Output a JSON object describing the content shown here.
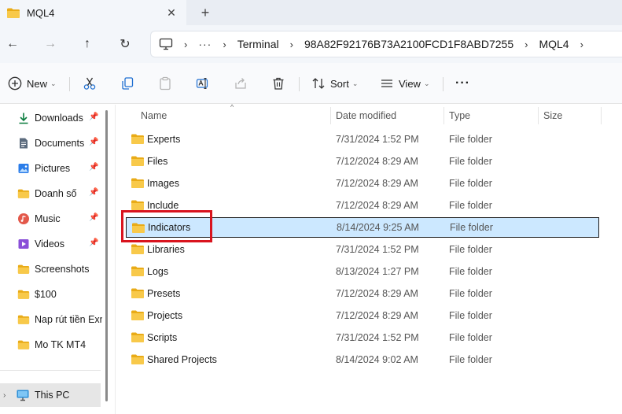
{
  "tab": {
    "title": "MQL4",
    "close_glyph": "✕",
    "new_tab_glyph": "+"
  },
  "nav": {
    "back_glyph": "←",
    "forward_glyph": "→",
    "up_glyph": "↑",
    "refresh_glyph": "↻"
  },
  "address": {
    "overflow_glyph": "···",
    "separator_glyph": "›",
    "crumbs": [
      "Terminal",
      "98A82F92176B73A2100FCD1F8ABD7255",
      "MQL4"
    ]
  },
  "toolbar": {
    "new_label": "New",
    "sort_label": "Sort",
    "view_label": "View",
    "more_glyph": "···",
    "caret_glyph": "⌄"
  },
  "sidebar": {
    "pin_glyph": "📌",
    "items": [
      {
        "label": "Downloads",
        "icon": "download-icon",
        "pinned": true
      },
      {
        "label": "Documents",
        "icon": "document-icon",
        "pinned": true
      },
      {
        "label": "Pictures",
        "icon": "picture-icon",
        "pinned": true
      },
      {
        "label": "Doanh số",
        "icon": "folder-icon",
        "pinned": true
      },
      {
        "label": "Music",
        "icon": "music-icon",
        "pinned": true
      },
      {
        "label": "Videos",
        "icon": "video-icon",
        "pinned": true
      },
      {
        "label": "Screenshots",
        "icon": "folder-icon",
        "pinned": false
      },
      {
        "label": "$100",
        "icon": "folder-icon",
        "pinned": false
      },
      {
        "label": "Nap rút tiền Exn",
        "icon": "folder-icon",
        "pinned": false
      },
      {
        "label": "Mo TK MT4",
        "icon": "folder-icon",
        "pinned": false
      }
    ],
    "this_pc": {
      "label": "This PC",
      "chevron_glyph": "›"
    }
  },
  "columns": {
    "name": "Name",
    "date": "Date modified",
    "type": "Type",
    "size": "Size",
    "sort_glyph": "^"
  },
  "files": [
    {
      "name": "Experts",
      "date": "7/31/2024 1:52 PM",
      "type": "File folder",
      "selected": false
    },
    {
      "name": "Files",
      "date": "7/12/2024 8:29 AM",
      "type": "File folder",
      "selected": false
    },
    {
      "name": "Images",
      "date": "7/12/2024 8:29 AM",
      "type": "File folder",
      "selected": false
    },
    {
      "name": "Include",
      "date": "7/12/2024 8:29 AM",
      "type": "File folder",
      "selected": false
    },
    {
      "name": "Indicators",
      "date": "8/14/2024 9:25 AM",
      "type": "File folder",
      "selected": true
    },
    {
      "name": "Libraries",
      "date": "7/31/2024 1:52 PM",
      "type": "File folder",
      "selected": false
    },
    {
      "name": "Logs",
      "date": "8/13/2024 1:27 PM",
      "type": "File folder",
      "selected": false
    },
    {
      "name": "Presets",
      "date": "7/12/2024 8:29 AM",
      "type": "File folder",
      "selected": false
    },
    {
      "name": "Projects",
      "date": "7/12/2024 8:29 AM",
      "type": "File folder",
      "selected": false
    },
    {
      "name": "Scripts",
      "date": "7/31/2024 1:52 PM",
      "type": "File folder",
      "selected": false
    },
    {
      "name": "Shared Projects",
      "date": "8/14/2024 9:02 AM",
      "type": "File folder",
      "selected": false
    }
  ],
  "colors": {
    "folder": "#f8c94a",
    "folder_dark": "#e9ab17",
    "selection": "#cce8ff",
    "annotation": "#d9141e",
    "accent": "#0a7c3e"
  }
}
